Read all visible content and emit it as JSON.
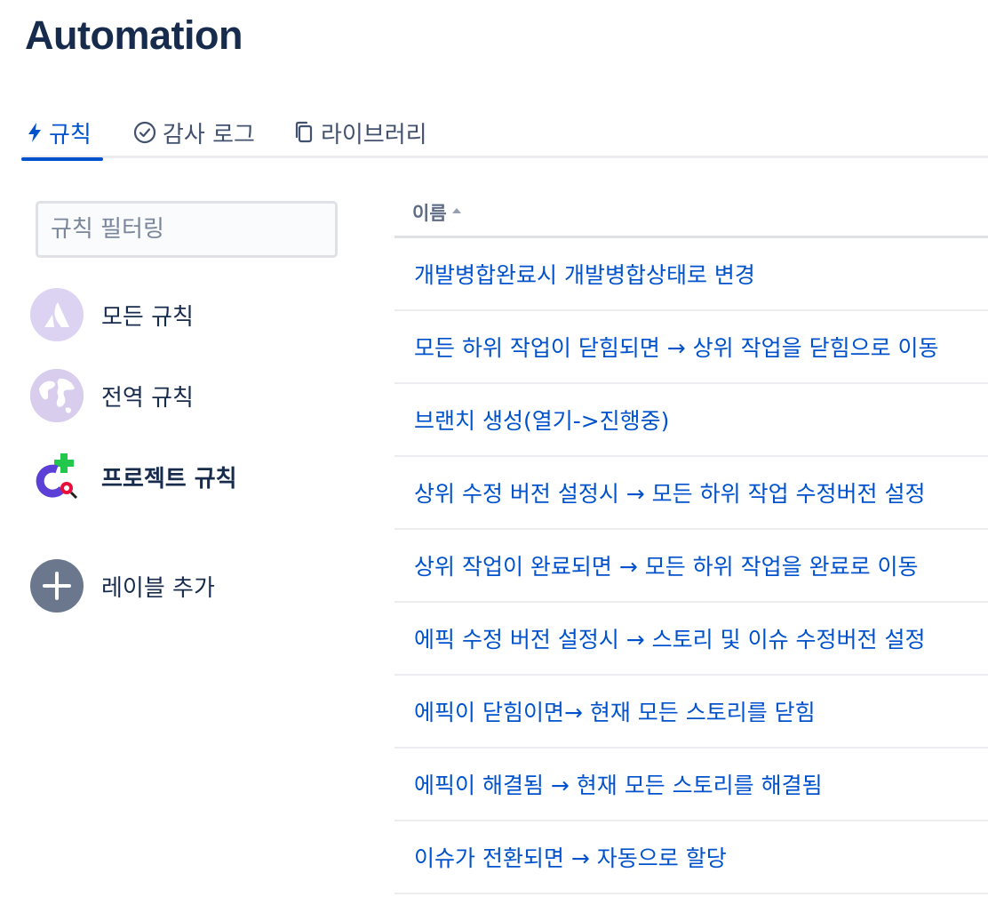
{
  "page": {
    "title": "Automation"
  },
  "tabs": [
    {
      "label": "규칙",
      "icon": "lightning-icon",
      "active": true
    },
    {
      "label": "감사 로그",
      "icon": "check-circle-icon",
      "active": false
    },
    {
      "label": "라이브러리",
      "icon": "copy-icon",
      "active": false
    }
  ],
  "sidebar": {
    "filter_placeholder": "규칙 필터링",
    "items": [
      {
        "label": "모든 규칙",
        "icon": "atlassian-logo-icon"
      },
      {
        "label": "전역 규칙",
        "icon": "globe-icon"
      },
      {
        "label": "프로젝트 규칙",
        "icon": "project-avatar-icon"
      }
    ],
    "add_label": "레이블 추가"
  },
  "table": {
    "column_name": "이름",
    "rules": [
      "개발병합완료시 개발병합상태로 변경",
      "모든 하위 작업이 닫힘되면 → 상위 작업을 닫힘으로 이동",
      "브랜치 생성(열기->진행중)",
      "상위 수정 버전 설정시 → 모든 하위 작업 수정버전 설정",
      "상위 작업이 완료되면 → 모든 하위 작업을 완료로 이동",
      "에픽 수정 버전 설정시 → 스토리 및 이슈 수정버전 설정",
      "에픽이 닫힘이면→ 현재 모든 스토리를 닫힘",
      "에픽이 해결됨 → 현재 모든 스토리를 해결됨",
      "이슈가 전환되면 → 자동으로 할당"
    ]
  },
  "colors": {
    "primary": "#0052cc",
    "text": "#172b4d",
    "muted": "#5e6c84",
    "border": "#dfe1e6"
  }
}
